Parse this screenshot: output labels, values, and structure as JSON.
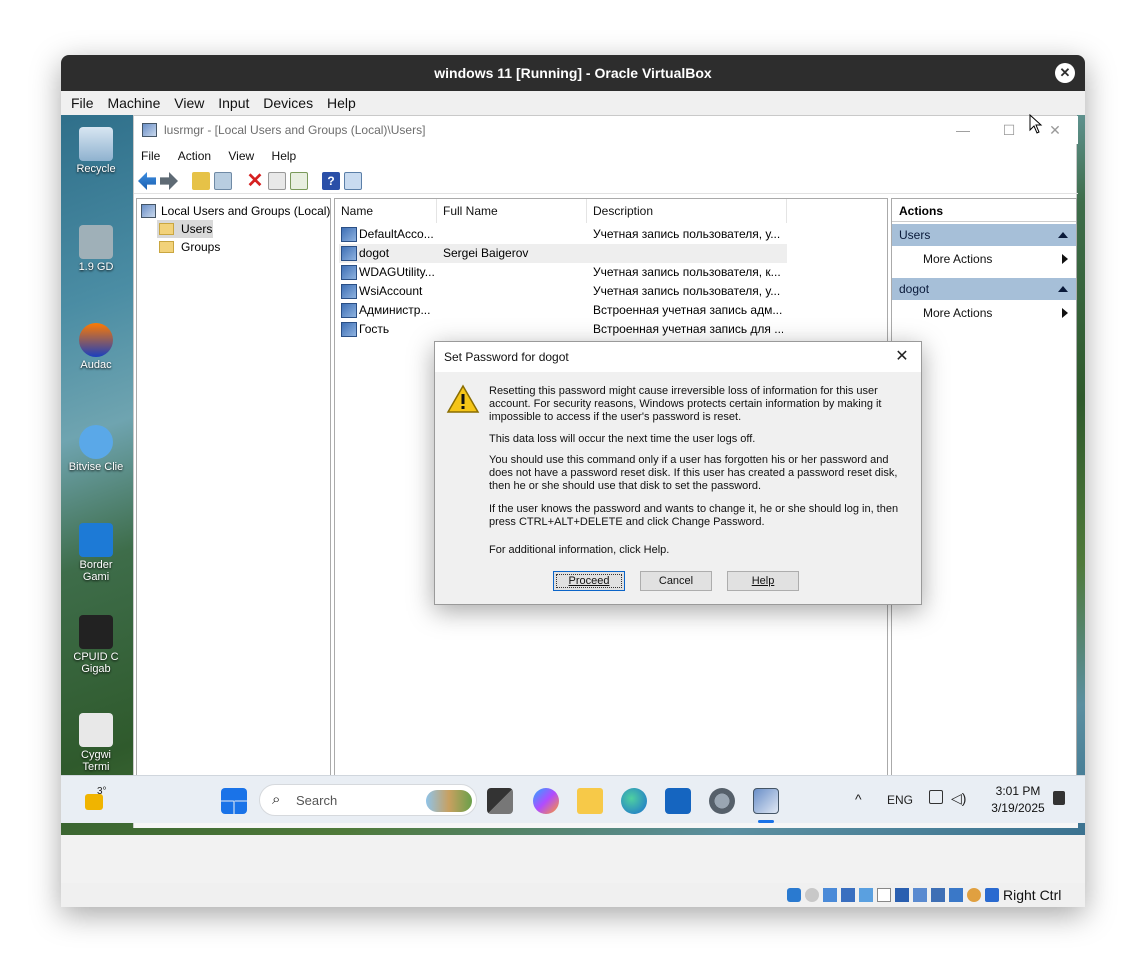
{
  "vbox": {
    "title": "windows 11 [Running] - Oracle VirtualBox",
    "menu": [
      "File",
      "Machine",
      "View",
      "Input",
      "Devices",
      "Help"
    ],
    "host_key": "Right Ctrl"
  },
  "desktop": {
    "icons": [
      "Recycle",
      "1.9 GD",
      "Audac",
      "Bitvise Clie",
      "Border Gami",
      "CPUID C Gigab",
      "Cygwi Termi"
    ]
  },
  "lusrmgr": {
    "title": "lusrmgr - [Local Users and Groups (Local)\\Users]",
    "menu": [
      "File",
      "Action",
      "View",
      "Help"
    ],
    "tree": {
      "root": "Local Users and Groups (Local)",
      "children": [
        "Users",
        "Groups"
      ]
    },
    "columns": [
      "Name",
      "Full Name",
      "Description"
    ],
    "rows": [
      {
        "name": "DefaultAcco...",
        "full": "",
        "desc": "Учетная запись пользователя, у..."
      },
      {
        "name": "dogot",
        "full": "Sergei Baigerov",
        "desc": ""
      },
      {
        "name": "WDAGUtility...",
        "full": "",
        "desc": "Учетная запись пользователя, к..."
      },
      {
        "name": "WsiAccount",
        "full": "",
        "desc": "Учетная запись пользователя, у..."
      },
      {
        "name": "Администр...",
        "full": "",
        "desc": "Встроенная учетная запись адм..."
      },
      {
        "name": "Гость",
        "full": "",
        "desc": "Встроенная учетная запись для ..."
      }
    ],
    "actions": {
      "header": "Actions",
      "sections": [
        {
          "title": "Users",
          "item": "More Actions"
        },
        {
          "title": "dogot",
          "item": "More Actions"
        }
      ]
    }
  },
  "dialog": {
    "title": "Set Password for dogot",
    "p1": "Resetting this password might cause irreversible loss of information for this user account. For security reasons, Windows protects certain information by making it impossible to access if the user's password is reset.",
    "p2": "This data loss will occur the next time the user logs off.",
    "p3": "You should use this command only if a user has forgotten his or her password and does not have a password reset disk. If this user has created a password reset disk, then he or she should use that disk to set the password.",
    "p4": "If the user knows the password and wants to change it, he or she should log in, then press CTRL+ALT+DELETE and click Change Password.",
    "p5": "For additional information, click Help.",
    "buttons": {
      "proceed": "Proceed",
      "cancel": "Cancel",
      "help": "Help"
    }
  },
  "taskbar": {
    "weather_temp": "3°",
    "search_placeholder": "Search",
    "language": "ENG",
    "time": "3:01 PM",
    "date": "3/19/2025"
  }
}
